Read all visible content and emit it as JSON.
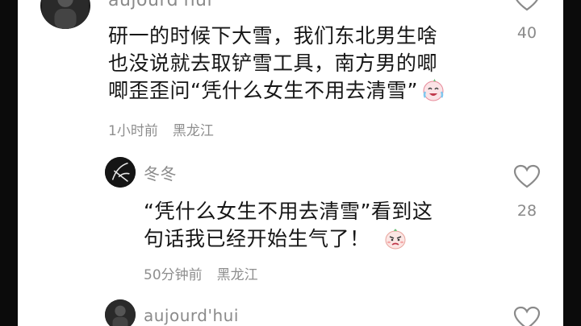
{
  "comments": [
    {
      "username": "aujourd'hui",
      "lines": [
        "研一的时候下大雪，我们东北男生啥",
        "也没说就去取铲雪工具，南方男的唧",
        "唧歪歪问“凭什么女生不用去清雪”"
      ],
      "emoji": "crying-laughing-emoji",
      "time": "1小时前",
      "region": "黑龙江",
      "likes": "40"
    },
    {
      "username": "冬冬",
      "lines": [
        "“凭什么女生不用去清雪”看到这",
        "句话我已经开始生气了！"
      ],
      "emoji": "angry-face-emoji",
      "time": "50分钟前",
      "region": "黑龙江",
      "likes": "28"
    },
    {
      "username": "aujourd'hui"
    }
  ],
  "colors": {
    "text": "#161616",
    "meta": "#8e8e8e",
    "background": "#ffffff"
  }
}
